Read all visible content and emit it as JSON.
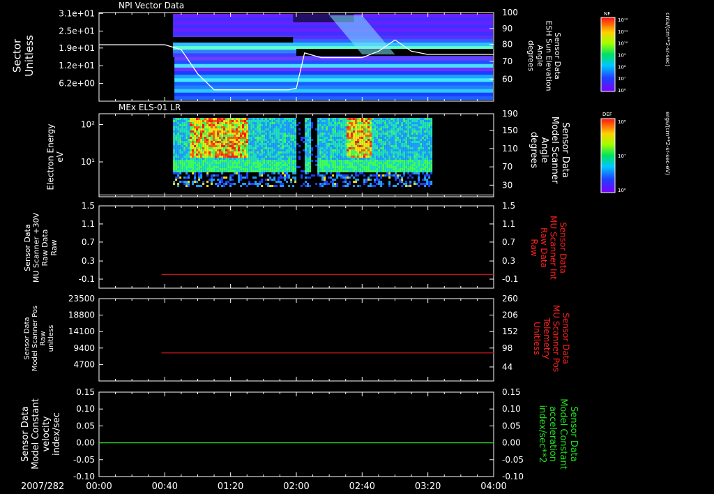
{
  "date_label": "2007/282",
  "x_ticks": [
    "00:00",
    "00:40",
    "01:20",
    "02:00",
    "02:40",
    "03:20",
    "04:00"
  ],
  "colors": {
    "background": "#000000",
    "axis": "#ffffff",
    "red_trace": "#e01818",
    "green_trace": "#28d828",
    "right_label_red": "#ff2020",
    "right_label_green": "#20e020"
  },
  "panels": [
    {
      "id": "npi",
      "title": "NPI Vector Data",
      "ylabel_left": [
        "Sector",
        "Unitless"
      ],
      "ylabel_right": [
        "Sensor Data",
        "ESH Sun Elevation",
        "Angle",
        "degrees"
      ],
      "yticks_left": [
        "3.1e+01",
        "2.5e+01",
        "1.9e+01",
        "1.2e+01",
        "6.2e+00"
      ],
      "yticks_right": [
        "100",
        "90",
        "80",
        "70",
        "60"
      ],
      "colorbar": {
        "label": "NF",
        "unit": "cnts/(cm**2-sr-sec)",
        "ticks": [
          "10¹²",
          "10¹¹",
          "10¹⁰",
          "10⁹",
          "10⁸",
          "10⁷",
          "10⁶"
        ]
      }
    },
    {
      "id": "els",
      "title": "MEx ELS-01 LR",
      "ylabel_left": [
        "Electron Energy",
        "eV"
      ],
      "ylabel_right": [
        "Sensor Data",
        "Model Scanner",
        "Angle",
        "degrees"
      ],
      "yticks_left": [
        "10²",
        "10¹"
      ],
      "yticks_right": [
        "190",
        "150",
        "110",
        "70",
        "30"
      ],
      "colorbar": {
        "label": "DEF",
        "unit": "ergs/(cm**2-sr-sec-eV)",
        "ticks": [
          "10⁸",
          "10⁷",
          "10⁶"
        ]
      }
    },
    {
      "id": "raw30",
      "ylabel_left": [
        "Sensor Data",
        "MU Scanner +30V",
        "Raw Data",
        "Raw"
      ],
      "ylabel_right": [
        "Sensor Data",
        "MU Scanner Int",
        "Raw Data",
        "Raw"
      ],
      "yticks_left": [
        "1.5",
        "1.1",
        "0.7",
        "0.3",
        "-0.1"
      ],
      "yticks_right": [
        "1.5",
        "1.1",
        "0.7",
        "0.3",
        "-0.1"
      ]
    },
    {
      "id": "pos",
      "ylabel_left": [
        "Sensor Data",
        "Model Scanner Pos",
        "Raw",
        "unitless"
      ],
      "ylabel_right": [
        "Sensor Data",
        "MU Scanner Pos",
        "Telemetry",
        "Unitless"
      ],
      "yticks_left": [
        "23500",
        "18800",
        "14100",
        "9400",
        "4700"
      ],
      "yticks_right": [
        "260",
        "206",
        "152",
        "98",
        "44"
      ]
    },
    {
      "id": "vel",
      "ylabel_left": [
        "Sensor Data",
        "Model Constant",
        "velocity",
        "index/sec"
      ],
      "ylabel_right": [
        "Sensor Data",
        "Model Constant",
        "acceleration",
        "index/sec**2"
      ],
      "yticks_left": [
        "0.15",
        "0.10",
        "0.05",
        "0.00",
        "-0.05",
        "-0.10"
      ],
      "yticks_right": [
        "0.15",
        "0.10",
        "0.05",
        "0.00",
        "-0.05",
        "-0.10"
      ]
    }
  ],
  "chart_data": [
    {
      "type": "heatmap",
      "title": "NPI Vector Data",
      "ylabel": "Sector Unitless",
      "y2label": "Sensor Data ESH Sun Elevation Angle degrees",
      "ylim": [
        0,
        31
      ],
      "y2lim": [
        45,
        100
      ],
      "xlim": [
        "00:00",
        "04:00"
      ],
      "data_start": "00:45",
      "series": [
        {
          "name": "Sun Elevation Angle",
          "x": [
            "00:00",
            "00:30",
            "00:40",
            "00:50",
            "01:00",
            "01:10",
            "01:20",
            "01:40",
            "01:55",
            "02:00",
            "02:05",
            "02:15",
            "02:40",
            "02:50",
            "03:00",
            "03:10",
            "03:20",
            "04:00"
          ],
          "values": [
            80,
            80,
            80,
            77,
            62,
            52,
            52,
            52,
            52,
            53,
            75,
            72,
            72,
            76,
            83,
            76,
            74,
            74
          ]
        }
      ]
    },
    {
      "type": "heatmap",
      "title": "MEx ELS-01 LR",
      "ylabel": "Electron Energy eV",
      "y2label": "Sensor Data Model Scanner Angle degrees",
      "yscale": "log",
      "ylim": [
        1,
        200
      ],
      "y2lim": [
        10,
        190
      ],
      "xlim": [
        "00:00",
        "04:00"
      ],
      "data_range": [
        "00:45",
        "03:22"
      ],
      "hotspots": [
        {
          "x": [
            "00:55",
            "01:30"
          ],
          "energy": [
            30,
            150
          ]
        },
        {
          "x": [
            "02:30",
            "02:45"
          ],
          "energy": [
            30,
            150
          ]
        }
      ],
      "series": [
        {
          "name": "Scanner Angle",
          "x": [
            "00:00",
            "04:00"
          ],
          "values": [
            14,
            14
          ]
        }
      ]
    },
    {
      "type": "line",
      "ylim": [
        -0.3,
        1.5
      ],
      "series": [
        {
          "name": "MU Scanner +30V",
          "x": [
            "00:38",
            "04:00"
          ],
          "values": [
            0.0,
            0.0
          ]
        }
      ]
    },
    {
      "type": "line",
      "ylim": [
        0,
        23500
      ],
      "series": [
        {
          "name": "Model Scanner Pos",
          "x": [
            "00:38",
            "04:00"
          ],
          "values": [
            8000,
            8000
          ]
        }
      ]
    },
    {
      "type": "line",
      "ylim": [
        -0.1,
        0.15
      ],
      "series": [
        {
          "name": "Model Constant velocity",
          "x": [
            "00:00",
            "04:00"
          ],
          "values": [
            0.0,
            0.0
          ]
        }
      ]
    }
  ]
}
